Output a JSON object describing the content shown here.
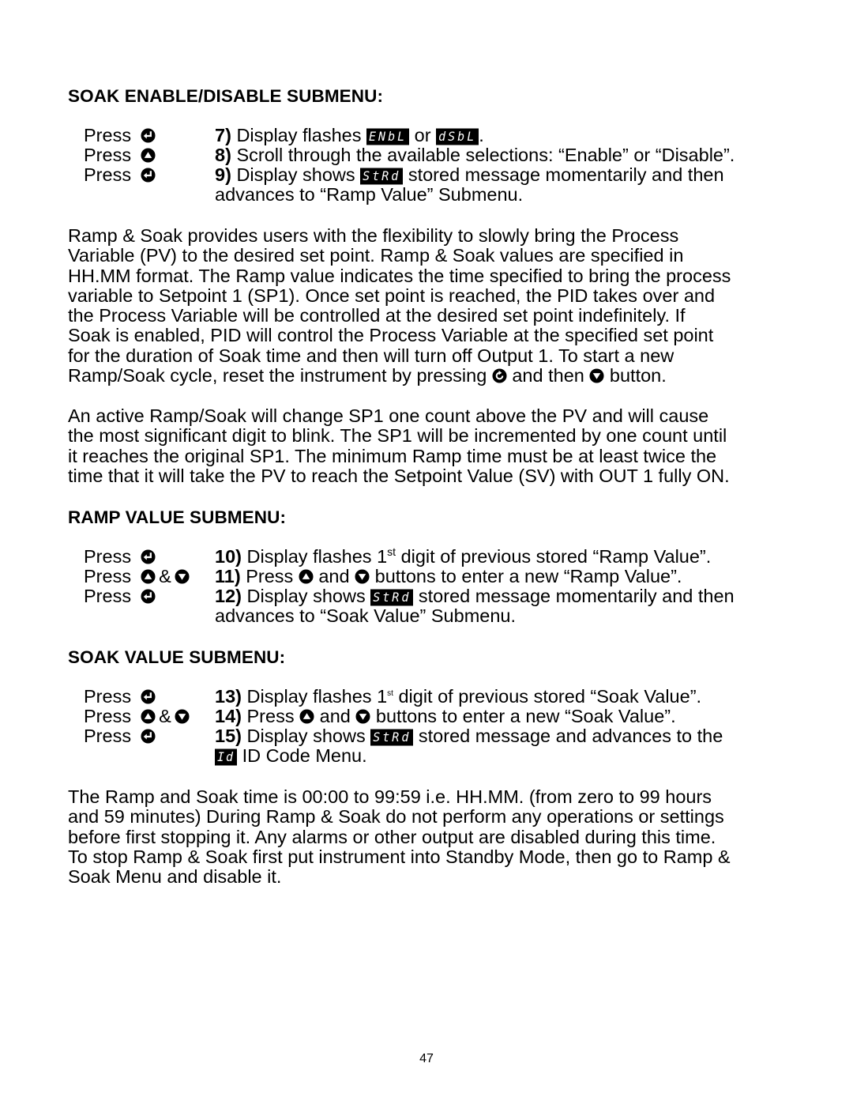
{
  "sections": {
    "soak_enable": {
      "heading": "SOAK ENABLE/DISABLE SUBMENU:",
      "steps": [
        {
          "press": "Press",
          "keys": [
            "enter-key"
          ],
          "num": "7)",
          "text_a": "Display flashes",
          "display_a": "ENbL",
          "text_b": "or",
          "display_b": "dSbL",
          "text_c": "."
        },
        {
          "press": "Press",
          "keys": [
            "up-key"
          ],
          "num": "8)",
          "text_a": "Scroll through the available selections: “Enable” or “Disable”."
        },
        {
          "press": "Press",
          "keys": [
            "enter-key"
          ],
          "num": "9)",
          "text_a": "Display shows",
          "display_a": "StRd",
          "text_b": "stored message momentarily and then",
          "continuation": "advances to “Ramp Value” Submenu."
        }
      ]
    },
    "paragraph1": {
      "lines": [
        "Ramp & Soak provides users with the flexibility to slowly bring the Process",
        "Variable (PV) to the desired set point. Ramp & Soak values are specified in",
        "HH.MM format. The Ramp value indicates the time specified to bring the process",
        "variable to Setpoint 1 (SP1). Once set point is reached, the PID takes over and",
        "the Process Variable will be controlled at the desired set point indefinitely. If",
        "Soak is enabled, PID will control the Process Variable at the specified set point",
        "for the duration of Soak time and then will turn off Output 1. To start a new"
      ],
      "last_line_a": "Ramp/Soak cycle, reset the instrument by pressing",
      "last_line_b": "and then",
      "last_line_c": "button."
    },
    "paragraph2": {
      "lines": [
        "An active Ramp/Soak will change SP1 one count above the PV and will cause",
        "the most significant digit to blink. The SP1 will be incremented by one count until",
        "it reaches the original SP1. The minimum Ramp time must be at least twice the",
        "time that it will take the PV to reach the Setpoint Value (SV) with OUT 1 fully ON."
      ]
    },
    "ramp_value": {
      "heading": "RAMP VALUE SUBMENU:",
      "steps": [
        {
          "press": "Press",
          "num": "10)",
          "text_a": "Display flashes 1",
          "sup": "st",
          "text_b": "digit of previous stored “Ramp Value”."
        },
        {
          "press": "Press",
          "amp": "&",
          "num": "11)",
          "text_a": "Press",
          "text_b": "and",
          "text_c": "buttons to enter a new “Ramp Value”."
        },
        {
          "press": "Press",
          "num": "12)",
          "text_a": "Display shows",
          "display_a": "StRd",
          "text_b": "stored message momentarily and then",
          "continuation": "advances to “Soak Value” Submenu."
        }
      ]
    },
    "soak_value": {
      "heading": "SOAK VALUE SUBMENU:",
      "steps": [
        {
          "press": "Press",
          "num": "13)",
          "text_a": "Display flashes 1",
          "sup": "st",
          "text_b": "digit of previous stored “Soak Value”."
        },
        {
          "press": "Press",
          "amp": "&",
          "num": "14)",
          "text_a": "Press",
          "text_b": "and",
          "text_c": "buttons to enter a new “Soak Value”."
        },
        {
          "press": "Press",
          "num": "15)",
          "text_a": "Display shows",
          "display_a": "StRd",
          "text_b": "stored message and advances to the",
          "display_cont": "Id",
          "continuation": "ID Code Menu."
        }
      ]
    },
    "paragraph3": {
      "lines": [
        "The Ramp and Soak time is 00:00 to 99:59 i.e. HH.MM. (from zero to 99 hours",
        "and 59 minutes) During Ramp & Soak do not perform any operations or settings",
        "before first stopping it. Any alarms or other output are disabled during this time.",
        "To stop Ramp & Soak first put instrument into Standby Mode, then go to Ramp &",
        "Soak Menu and disable it."
      ]
    }
  },
  "page_number": "47"
}
